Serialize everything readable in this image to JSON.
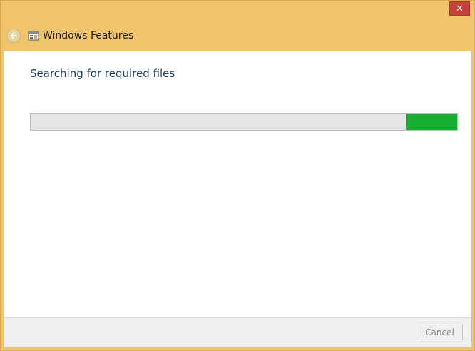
{
  "window": {
    "title": "Windows Features",
    "close_glyph": "✕",
    "back_icon": "back-arrow-icon",
    "app_icon": "windows-features-icon"
  },
  "main": {
    "status_heading": "Searching for required files",
    "progress": {
      "indicator_start_fraction": 0.879,
      "indicator_end_fraction": 1.0,
      "indicator_color": "#14b02e",
      "track_color": "#e6e6e6"
    }
  },
  "footer": {
    "cancel_label": "Cancel",
    "cancel_enabled": false
  },
  "colors": {
    "frame": "#f0c46b",
    "close": "#c7413b",
    "heading": "#1e3f6e"
  }
}
